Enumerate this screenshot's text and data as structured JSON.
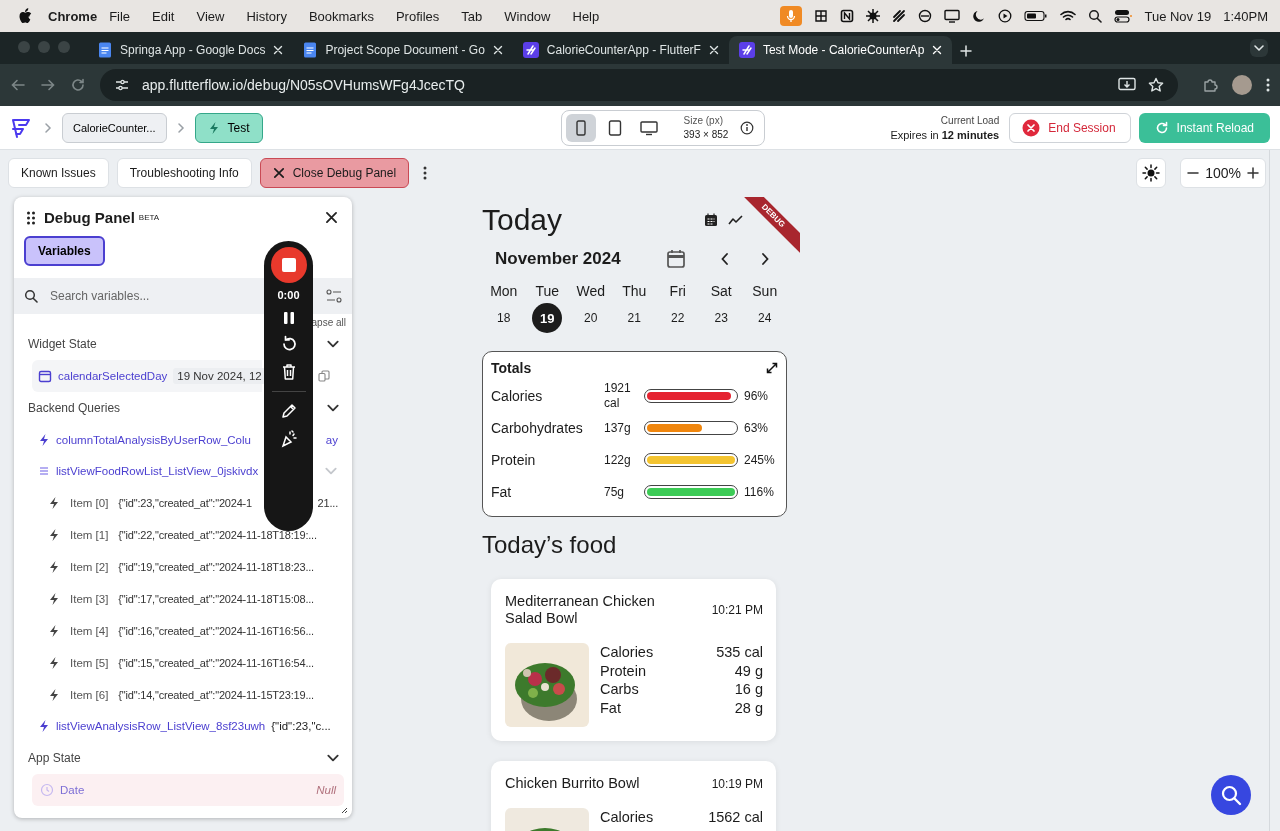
{
  "menubar": {
    "app": "Chrome",
    "menus": [
      "File",
      "Edit",
      "View",
      "History",
      "Bookmarks",
      "Profiles",
      "Tab",
      "Window",
      "Help"
    ],
    "date": "Tue Nov 19",
    "time": "1:40PM"
  },
  "browser": {
    "tabs": [
      {
        "title": "Springa App - Google Docs",
        "kind": "document",
        "selected": false
      },
      {
        "title": "Project Scope Document - Go",
        "kind": "document",
        "selected": false
      },
      {
        "title": "CalorieCounterApp - FlutterF",
        "kind": "app",
        "selected": false
      },
      {
        "title": "Test Mode - CalorieCounterAp",
        "kind": "app",
        "selected": true
      }
    ],
    "url": "app.flutterflow.io/debug/N05sOVHumsWFg4JcecTQ"
  },
  "toolbar": {
    "project": "CalorieCounter...",
    "mode": "Test",
    "devices": [
      {
        "kind": "phone",
        "selected": true
      },
      {
        "kind": "tablet",
        "selected": false
      },
      {
        "kind": "desktop",
        "selected": false
      }
    ],
    "size_label": "Size (px)",
    "size": "393 × 852",
    "load_label": "Current Load",
    "expires": "Expires in **12 minutes**",
    "end_session": "End Session",
    "reload": "Instant Reload"
  },
  "actions": {
    "buttons": [
      {
        "label": "Known Issues",
        "kind": "plain"
      },
      {
        "label": "Troubleshooting Info",
        "kind": "plain"
      },
      {
        "label": "Close Debug Panel",
        "kind": "danger"
      }
    ],
    "zoom": "100%"
  },
  "debug_panel": {
    "title": "Debug Panel",
    "badge": "BETA",
    "tabs": [
      {
        "label": "Variables",
        "selected": true
      }
    ],
    "search_placeholder": "Search variables...",
    "collapse": "apse all",
    "sections": [
      {
        "title": "Widget State",
        "expanded": true,
        "rows": [
          {
            "kind": "widget",
            "name": "calendarSelectedDay",
            "value": "19 Nov 2024, 12"
          }
        ]
      },
      {
        "title": "Backend Queries",
        "expanded": true,
        "rows": [
          {
            "kind": "query",
            "name": "columnTotalAnalysisByUserRow_Colu",
            "tail": "ay"
          },
          {
            "kind": "list",
            "name": "listViewFoodRowList_ListView_0jskivdx",
            "expanded": true,
            "children": [
              {
                "label": "Item [0]",
                "value": "{\"id\":23,\"created_at\":\"2024-1",
                "tail": "21..."
              },
              {
                "label": "Item [1]",
                "value": "{\"id\":22,\"created_at\":\"2024-11-18T18:19:..."
              },
              {
                "label": "Item [2]",
                "value": "{\"id\":19,\"created_at\":\"2024-11-18T18:23..."
              },
              {
                "label": "Item [3]",
                "value": "{\"id\":17,\"created_at\":\"2024-11-18T15:08..."
              },
              {
                "label": "Item [4]",
                "value": "{\"id\":16,\"created_at\":\"2024-11-16T16:56..."
              },
              {
                "label": "Item [5]",
                "value": "{\"id\":15,\"created_at\":\"2024-11-16T16:54..."
              },
              {
                "label": "Item [6]",
                "value": "{\"id\":14,\"created_at\":\"2024-11-15T23:19..."
              }
            ]
          },
          {
            "kind": "query",
            "name": "listViewAnalysisRow_ListView_8sf23uwh",
            "value": "{\"id\":23,\"c..."
          }
        ]
      },
      {
        "title": "App State",
        "expanded": true,
        "rows": [
          {
            "kind": "app",
            "name": "Date",
            "value": "Null"
          }
        ]
      }
    ]
  },
  "recorder": {
    "timer": "0:00"
  },
  "phone": {
    "title": "Today",
    "banner": "DEBUG",
    "month": "November 2024",
    "days": [
      {
        "day": "Mon",
        "date": "18",
        "selected": false
      },
      {
        "day": "Tue",
        "date": "19",
        "selected": true
      },
      {
        "day": "Wed",
        "date": "20",
        "selected": false
      },
      {
        "day": "Thu",
        "date": "21",
        "selected": false
      },
      {
        "day": "Fri",
        "date": "22",
        "selected": false
      },
      {
        "day": "Sat",
        "date": "23",
        "selected": false
      },
      {
        "day": "Sun",
        "date": "24",
        "selected": false
      }
    ],
    "totals": {
      "title": "Totals",
      "rows": [
        {
          "name": "Calories",
          "amount": "1921 cal",
          "level": 0.96,
          "percent": "96%",
          "color": "#e52330"
        },
        {
          "name": "Carbohydrates",
          "amount": "137g",
          "level": 0.63,
          "percent": "63%",
          "color": "#f0860d"
        },
        {
          "name": "Protein",
          "amount": "122g",
          "level": 1,
          "percent": "245%",
          "color": "#f4c430"
        },
        {
          "name": "Fat",
          "amount": "75g",
          "level": 1,
          "percent": "116%",
          "color": "#3ccb55"
        }
      ]
    },
    "food_title": "Today’s food",
    "foods": [
      {
        "name": "Mediterranean Chicken Salad Bowl",
        "time": "10:21 PM",
        "nutrients": [
          {
            "label": "Calories",
            "value": "535 cal"
          },
          {
            "label": "Protein",
            "value": "49 g"
          },
          {
            "label": "Carbs",
            "value": "16 g"
          },
          {
            "label": "Fat",
            "value": "28 g"
          }
        ]
      },
      {
        "name": "Chicken Burrito Bowl",
        "time": "10:19 PM",
        "nutrients": [
          {
            "label": "Calories",
            "value": "1562 cal"
          }
        ]
      }
    ]
  }
}
